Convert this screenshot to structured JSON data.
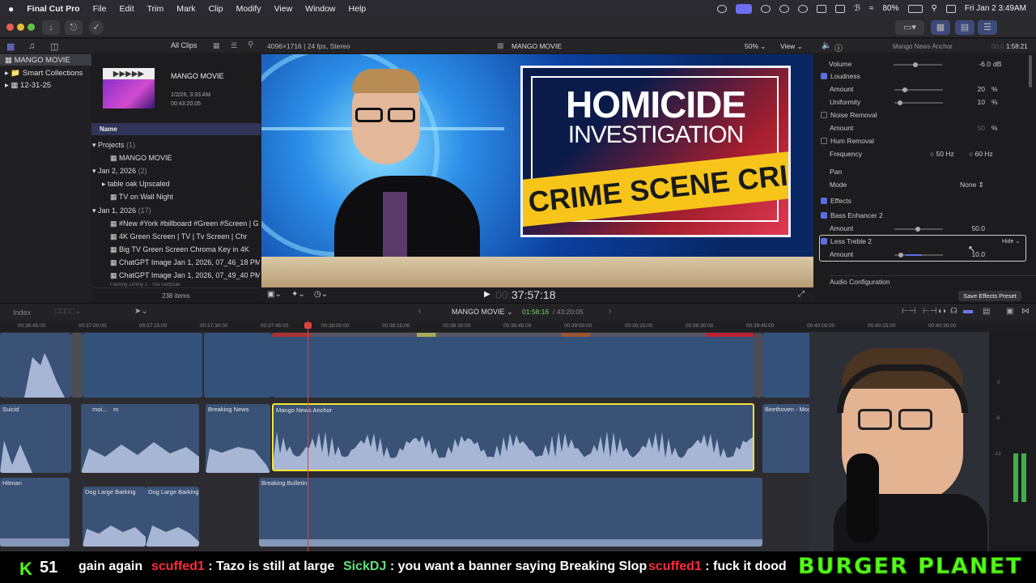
{
  "menubar": {
    "app": "Final Cut Pro",
    "items": [
      "File",
      "Edit",
      "Trim",
      "Mark",
      "Clip",
      "Modify",
      "View",
      "Window",
      "Help"
    ],
    "battery": "80%",
    "datetime": "Fri Jan 2  3:49AM"
  },
  "library": {
    "items": [
      {
        "label": "MANGO MOVIE",
        "selected": true
      },
      {
        "label": "Smart Collections",
        "selected": false
      },
      {
        "label": "12-31-25",
        "selected": false
      }
    ]
  },
  "browser": {
    "filter": "All Clips",
    "project_title": "MANGO MOVIE",
    "project_date": "1/2/26, 3:33 AM",
    "project_duration": "00:43:20:05",
    "column_name": "Name",
    "groups": [
      {
        "label": "Projects",
        "count": "(1)"
      },
      {
        "label": "Jan 2, 2026",
        "count": "(2)"
      },
      {
        "label": "Jan 1, 2026",
        "count": "(17)"
      }
    ],
    "rows": [
      "MANGO MOVIE",
      "table oak Upscaled",
      "TV on Wall Night",
      "#New #York #billboard #Green #Screen | G",
      "4K Green Screen  |  TV  |  Tv Screen  |  Chr",
      "Big TV Green Screen Chroma Key in 4K",
      "ChatGPT Image Jan 1, 2026, 07_46_18 PM",
      "ChatGPT Image Jan 1, 2026, 07_49_40 PM",
      "Flaming Zimmy 1 - The Gimpsiel"
    ],
    "item_count": "238 items"
  },
  "viewer": {
    "format": "4096×1716 | 24 fps, Stereo",
    "title": "MANGO MOVIE",
    "zoom": "50%",
    "view_label": "View",
    "timecode": "37:57:18",
    "timecode_prefix": "00:",
    "headline1": "HOMICIDE",
    "headline2": "INVESTIGATION",
    "tape_text": "CRIME SCENE  CRIME SCENE"
  },
  "inspector": {
    "clip_name": "Mango News Anchor",
    "clip_time": "1:58:21",
    "clip_time_prefix": "00:0",
    "volume_label": "Volume",
    "volume_value": "-6.0",
    "volume_unit": "dB",
    "loudness_label": "Loudness",
    "amount_label": "Amount",
    "loudness_amount": "20",
    "uniformity_label": "Uniformity",
    "uniformity_value": "10",
    "pct": "%",
    "noise_label": "Noise Removal",
    "noise_amount": "50",
    "hum_label": "Hum Removal",
    "frequency_label": "Frequency",
    "freq_50": "50 Hz",
    "freq_60": "60 Hz",
    "pan_label": "Pan",
    "mode_label": "Mode",
    "mode_value": "None",
    "effects_label": "Effects",
    "bass_label": "Bass Enhancer 2",
    "bass_amount": "50.0",
    "treble_label": "Less Treble 2",
    "treble_amount": "10.0",
    "hide_label": "Hide",
    "audio_config_label": "Audio Configuration",
    "save_preset": "Save Effects Preset"
  },
  "timeline": {
    "index_label": "Index",
    "project": "MANGO MOVIE",
    "position": "01:58:16",
    "duration": "/ 43:20:05",
    "ruler": [
      "00:36:45:00",
      "00:37:00:00",
      "00:37:15:00",
      "00:37:30:00",
      "00:37:45:00",
      "00:38:00:00",
      "00:38:15:00",
      "00:38:30:00",
      "00:38:45:00",
      "00:39:00:00",
      "00:39:15:00",
      "00:39:30:00",
      "00:39:45:00",
      "00:40:00:00",
      "00:40:15:00",
      "00:40:30:00"
    ],
    "clips": {
      "suicid": "Suicid",
      "breaking_news": "Breaking News",
      "mango_anchor": "Mango News Anchor",
      "beethoven": "Beethoven - Moonlight Sonata",
      "hitman": "Hitman",
      "dog1": "Dog Large Barking",
      "dog2": "Dog Large Barking",
      "bulletin": "Breaking Bulletin",
      "m1": "m",
      "moi": "moi..."
    },
    "meter_labels": [
      "0",
      "-6",
      "-12"
    ]
  },
  "stream": {
    "kick_count": "51",
    "chat": [
      {
        "user": "",
        "msg": "gain again",
        "color": "#ffffff"
      },
      {
        "user": "scuffed1",
        "msg": " : Tazo is still at large",
        "color": "#ff2a3a"
      },
      {
        "user": "SickDJ",
        "msg": " : you want a banner saying Breaking Slop",
        "color": "#5fe07a"
      },
      {
        "user": "scuffed1",
        "msg": " : fuck it dood",
        "color": "#ff2a3a"
      }
    ],
    "brand": "BURGER PLANET"
  },
  "colors": {
    "accent": "#5b6ee1",
    "selection_yellow": "#f2e33a",
    "playhead": "#e0413b",
    "clip_blue": "#3a5578",
    "kick_green": "#53fc18"
  }
}
